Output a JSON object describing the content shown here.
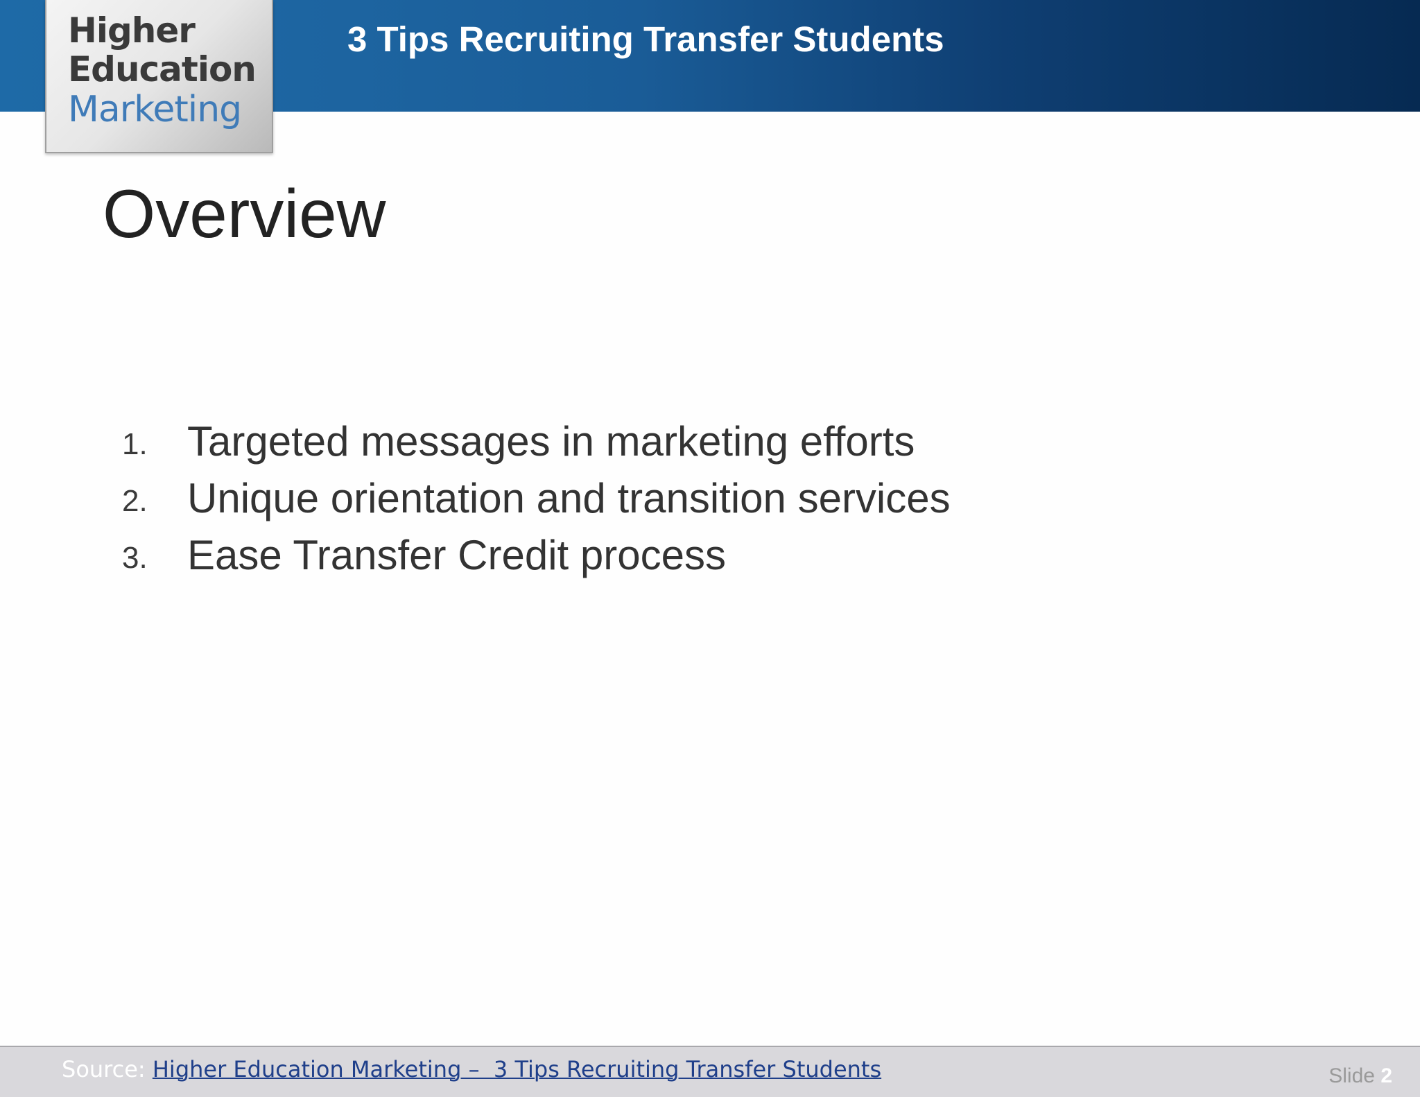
{
  "header": {
    "title": "3 Tips Recruiting Transfer Students"
  },
  "logo": {
    "line1": "Higher",
    "line2": "Education",
    "line3": "Marketing"
  },
  "slide": {
    "title": "Overview",
    "items": [
      {
        "number": "1.",
        "text": "Targeted messages in marketing efforts"
      },
      {
        "number": "2.",
        "text": "Unique orientation and transition services"
      },
      {
        "number": "3.",
        "text": "Ease Transfer Credit process"
      }
    ]
  },
  "footer": {
    "source_label": "Source:",
    "source_link": "Higher Education Marketing –  3 Tips Recruiting Transfer Students",
    "slide_label": "Slide",
    "slide_number": "2"
  },
  "colors": {
    "header_blue": "#1e6aa7",
    "header_navy": "#062a52",
    "logo_blue": "#3f7bb8",
    "link_blue": "#1f3f8a",
    "footer_gray": "#d9d8dc"
  }
}
